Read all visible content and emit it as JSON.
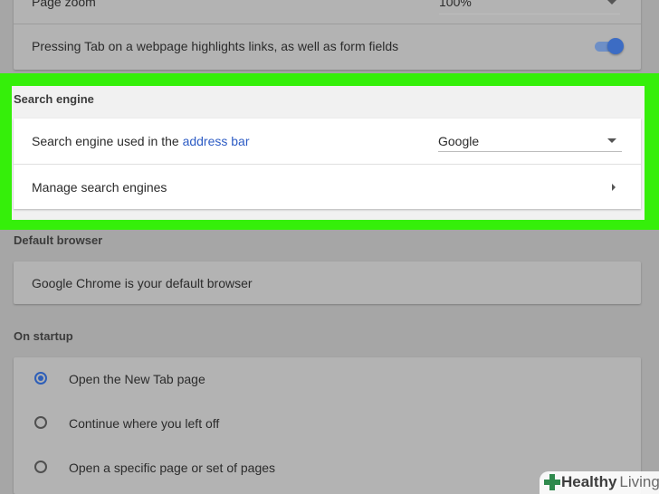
{
  "accessibility": {
    "page_zoom_label": "Page zoom",
    "page_zoom_value": "100%",
    "tab_highlight_label": "Pressing Tab on a webpage highlights links, as well as form fields",
    "tab_highlight_enabled": true
  },
  "search_engine": {
    "title": "Search engine",
    "used_in_prefix": "Search engine used in the",
    "used_in_link": "address bar",
    "selected_engine": "Google",
    "manage_label": "Manage search engines"
  },
  "default_browser": {
    "title": "Default browser",
    "status": "Google Chrome is your default browser"
  },
  "on_startup": {
    "title": "On startup",
    "options": [
      {
        "label": "Open the New Tab page",
        "selected": true
      },
      {
        "label": "Continue where you left off",
        "selected": false
      },
      {
        "label": "Open a specific page or set of pages",
        "selected": false
      }
    ]
  },
  "watermark": {
    "bold": "Healthy",
    "light": "Living"
  },
  "colors": {
    "highlight": "#35ef0a",
    "accent": "#2d5cc4"
  }
}
